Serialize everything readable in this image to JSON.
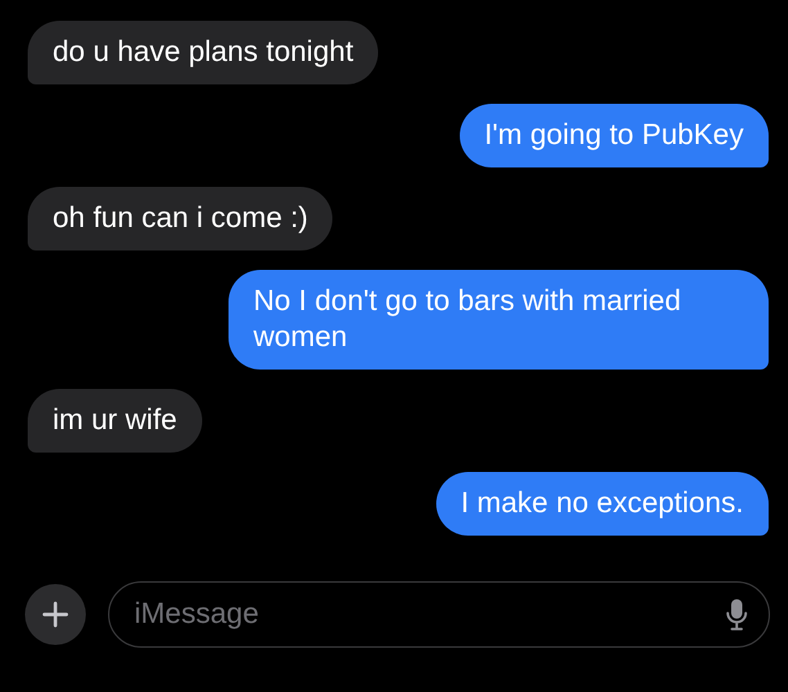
{
  "messages": [
    {
      "kind": "received",
      "text": "do u have plans tonight"
    },
    {
      "kind": "sent",
      "text": "I'm going to PubKey"
    },
    {
      "kind": "received",
      "text": "oh fun can i come :)"
    },
    {
      "kind": "sent",
      "text": "No I don't go to bars with married women"
    },
    {
      "kind": "received",
      "text": "im ur wife"
    },
    {
      "kind": "sent",
      "text": "I make no exceptions."
    }
  ],
  "composer": {
    "placeholder": "iMessage"
  }
}
